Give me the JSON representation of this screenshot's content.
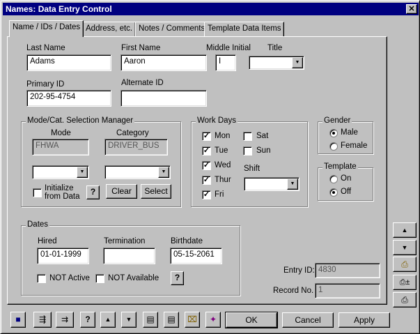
{
  "window": {
    "title": "Names: Data Entry Control",
    "close_label": "✕"
  },
  "tabs": [
    {
      "label": "Name / IDs / Dates",
      "active": true
    },
    {
      "label": "Address, etc.",
      "active": false
    },
    {
      "label": "Notes / Comments",
      "active": false
    },
    {
      "label": "Template Data Items",
      "active": false
    }
  ],
  "name": {
    "last_label": "Last Name",
    "last_value": "Adams",
    "first_label": "First Name",
    "first_value": "Aaron",
    "middle_label": "Middle Initial",
    "middle_value": "I",
    "title_label": "Title",
    "title_value": ""
  },
  "ids": {
    "primary_label": "Primary ID",
    "primary_value": "202-95-4754",
    "alternate_label": "Alternate ID",
    "alternate_value": ""
  },
  "mode_cat": {
    "legend": "Mode/Cat. Selection Manager",
    "mode_label": "Mode",
    "mode_value": "FHWA",
    "category_label": "Category",
    "category_value": "DRIVER_BUS",
    "initialize_label_1": "Initialize",
    "initialize_label_2": "from Data",
    "clear_label": "Clear",
    "select_label": "Select"
  },
  "work_days": {
    "legend": "Work Days",
    "days": [
      {
        "label": "Mon",
        "checked": true
      },
      {
        "label": "Tue",
        "checked": true
      },
      {
        "label": "Wed",
        "checked": true
      },
      {
        "label": "Thur",
        "checked": true
      },
      {
        "label": "Fri",
        "checked": true
      },
      {
        "label": "Sat",
        "checked": false
      },
      {
        "label": "Sun",
        "checked": false
      }
    ],
    "shift_label": "Shift"
  },
  "gender": {
    "legend": "Gender",
    "male_label": "Male",
    "female_label": "Female",
    "selected": "Male"
  },
  "template": {
    "legend": "Template",
    "on_label": "On",
    "off_label": "Off",
    "selected": "Off"
  },
  "dates": {
    "legend": "Dates",
    "hired_label": "Hired",
    "hired_value": "01-01-1999",
    "termination_label": "Termination",
    "termination_value": "",
    "birthdate_label": "Birthdate",
    "birthdate_value": "05-15-2061",
    "not_active_label": "NOT Active",
    "not_available_label": "NOT Available"
  },
  "record": {
    "entry_label": "Entry ID:",
    "entry_value": "4830",
    "record_label": "Record No.",
    "record_value": "1"
  },
  "footer": {
    "ok_label": "OK",
    "cancel_label": "Cancel",
    "apply_label": "Apply"
  },
  "glyphs": {
    "check": "✓",
    "help": "?",
    "up": "▲",
    "down": "▼",
    "combo": "▼",
    "save": "■",
    "import": "⇶",
    "export": "⇉",
    "doc": "▤",
    "clip": "⌧",
    "wizard": "✦",
    "print": "⎙",
    "print_plus": "⎙±"
  },
  "colors": {
    "titlebar": "#000080",
    "face": "#c0c0c0"
  }
}
